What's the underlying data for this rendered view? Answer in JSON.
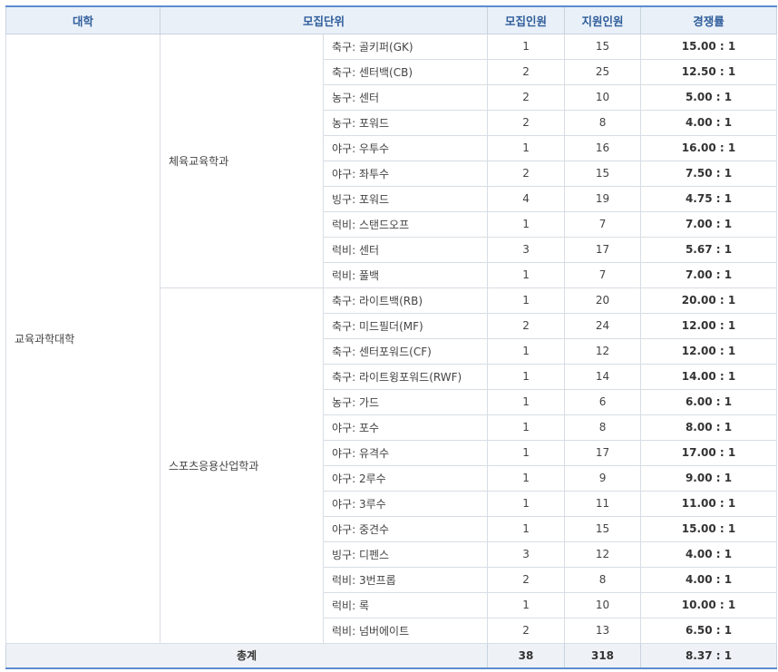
{
  "headers": [
    "대학",
    "모집단위",
    "모집인원",
    "지원인원",
    "경쟁률"
  ],
  "college": "교육과학대학",
  "departments": [
    {
      "name": "체육교육학과",
      "rows": [
        {
          "unit": "축구: 골키퍼(GK)",
          "recruit": "1",
          "apply": "15",
          "ratio": "15.00 : 1"
        },
        {
          "unit": "축구: 센터백(CB)",
          "recruit": "2",
          "apply": "25",
          "ratio": "12.50 : 1"
        },
        {
          "unit": "농구: 센터",
          "recruit": "2",
          "apply": "10",
          "ratio": "5.00 : 1"
        },
        {
          "unit": "농구: 포워드",
          "recruit": "2",
          "apply": "8",
          "ratio": "4.00 : 1"
        },
        {
          "unit": "야구: 우투수",
          "recruit": "1",
          "apply": "16",
          "ratio": "16.00 : 1"
        },
        {
          "unit": "야구: 좌투수",
          "recruit": "2",
          "apply": "15",
          "ratio": "7.50 : 1"
        },
        {
          "unit": "빙구: 포워드",
          "recruit": "4",
          "apply": "19",
          "ratio": "4.75 : 1"
        },
        {
          "unit": "럭비: 스탠드오프",
          "recruit": "1",
          "apply": "7",
          "ratio": "7.00 : 1"
        },
        {
          "unit": "럭비: 센터",
          "recruit": "3",
          "apply": "17",
          "ratio": "5.67 : 1"
        },
        {
          "unit": "럭비: 풀백",
          "recruit": "1",
          "apply": "7",
          "ratio": "7.00 : 1"
        }
      ]
    },
    {
      "name": "스포츠응용산업학과",
      "rows": [
        {
          "unit": "축구: 라이트백(RB)",
          "recruit": "1",
          "apply": "20",
          "ratio": "20.00 : 1"
        },
        {
          "unit": "축구: 미드필더(MF)",
          "recruit": "2",
          "apply": "24",
          "ratio": "12.00 : 1"
        },
        {
          "unit": "축구: 센터포워드(CF)",
          "recruit": "1",
          "apply": "12",
          "ratio": "12.00 : 1"
        },
        {
          "unit": "축구: 라이트윙포워드(RWF)",
          "recruit": "1",
          "apply": "14",
          "ratio": "14.00 : 1"
        },
        {
          "unit": "농구: 가드",
          "recruit": "1",
          "apply": "6",
          "ratio": "6.00 : 1"
        },
        {
          "unit": "야구: 포수",
          "recruit": "1",
          "apply": "8",
          "ratio": "8.00 : 1"
        },
        {
          "unit": "야구: 유격수",
          "recruit": "1",
          "apply": "17",
          "ratio": "17.00 : 1"
        },
        {
          "unit": "야구: 2루수",
          "recruit": "1",
          "apply": "9",
          "ratio": "9.00 : 1"
        },
        {
          "unit": "야구: 3루수",
          "recruit": "1",
          "apply": "11",
          "ratio": "11.00 : 1"
        },
        {
          "unit": "야구: 중견수",
          "recruit": "1",
          "apply": "15",
          "ratio": "15.00 : 1"
        },
        {
          "unit": "빙구: 디펜스",
          "recruit": "3",
          "apply": "12",
          "ratio": "4.00 : 1"
        },
        {
          "unit": "럭비: 3번프롭",
          "recruit": "2",
          "apply": "8",
          "ratio": "4.00 : 1"
        },
        {
          "unit": "럭비: 록",
          "recruit": "1",
          "apply": "10",
          "ratio": "10.00 : 1"
        },
        {
          "unit": "럭비: 넘버에이트",
          "recruit": "2",
          "apply": "13",
          "ratio": "6.50 : 1"
        }
      ]
    }
  ],
  "total": {
    "label": "총계",
    "recruit": "38",
    "apply": "318",
    "ratio": "8.37 : 1"
  }
}
